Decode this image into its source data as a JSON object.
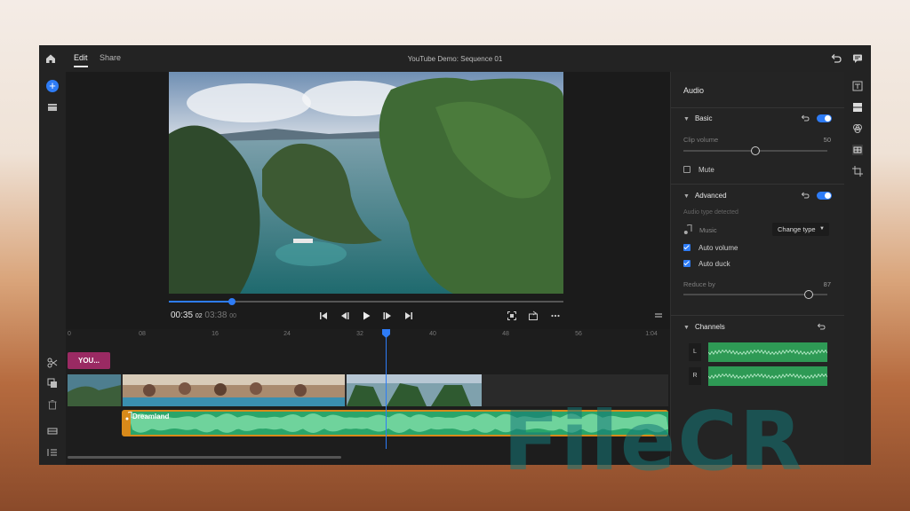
{
  "app": {
    "tabs": [
      {
        "label": "Edit"
      },
      {
        "label": "Share"
      }
    ],
    "sequence_title": "YouTube Demo: Sequence 01"
  },
  "player": {
    "current_time": "00:35",
    "current_frames": "02",
    "total_time": "03:38",
    "total_frames": "00",
    "progress": 0.16
  },
  "timeline": {
    "ruler_ticks": [
      "0",
      "08",
      "16",
      "24",
      "32",
      "40",
      "48",
      "56",
      "1:04"
    ],
    "title_clip_label": "YOU...",
    "audio_clip_label": "Dreamland"
  },
  "audio_panel": {
    "title": "Audio",
    "basic": {
      "header": "Basic",
      "clip_volume_label": "Clip volume",
      "clip_volume_value": "50",
      "clip_volume_level": 0.5,
      "mute_label": "Mute",
      "mute_checked": false
    },
    "advanced": {
      "header": "Advanced",
      "detected_label": "Audio type detected",
      "type_label": "Music",
      "change_type_label": "Change type",
      "auto_volume_label": "Auto volume",
      "auto_volume_checked": true,
      "auto_duck_label": "Auto duck",
      "auto_duck_checked": true,
      "reduce_by_label": "Reduce by",
      "reduce_by_value": "87",
      "reduce_by_level": 0.87
    },
    "channels": {
      "header": "Channels",
      "items": [
        {
          "label": "L"
        },
        {
          "label": "R"
        }
      ]
    }
  },
  "watermark": "FileCR",
  "colors": {
    "accent": "#2e7cf6",
    "audio_clip": "#d88a1a",
    "title_clip": "#9a2a63",
    "wave": "#2e9a55"
  }
}
